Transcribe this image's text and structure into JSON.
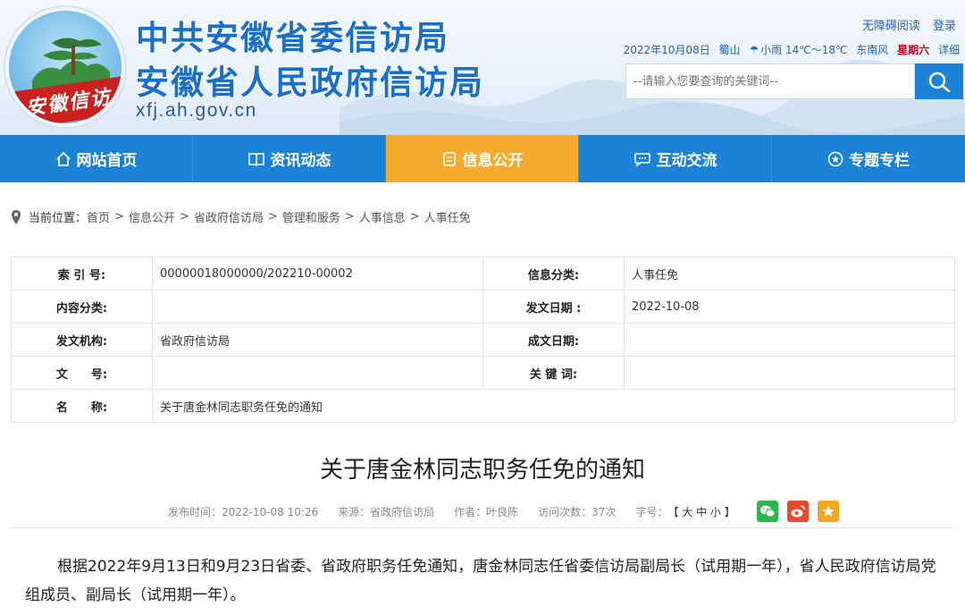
{
  "header": {
    "logo_text": "安徽信访",
    "title_line1": "中共安徽省委信访局",
    "title_line2": "安徽省人民政府信访局",
    "domain": "xfj.ah.gov.cn",
    "links": {
      "accessible": "无障碍阅读",
      "login": "登录"
    },
    "info": {
      "date": "2022年10月08日",
      "city": "蜀山",
      "weather": "小雨 14℃～18℃",
      "wind": "东南风",
      "weekday": "星期六",
      "detail": "详细"
    },
    "search": {
      "placeholder": "--请输入您要查询的关键词--"
    }
  },
  "nav": [
    {
      "label": "网站首页",
      "icon": "home-icon"
    },
    {
      "label": "资讯动态",
      "icon": "book-icon"
    },
    {
      "label": "信息公开",
      "icon": "document-icon",
      "active": true
    },
    {
      "label": "互动交流",
      "icon": "chat-icon"
    },
    {
      "label": "专题专栏",
      "icon": "star-circle-icon"
    }
  ],
  "breadcrumb": {
    "prefix": "当前位置：",
    "items": [
      "首页",
      "信息公开",
      "省政府信访局",
      "管理和服务",
      "人事信息",
      "人事任免"
    ]
  },
  "meta": {
    "rows": [
      {
        "k1": "索 引 号:",
        "v1": "00000018000000/202210-00002",
        "k2": "信息分类:",
        "v2": "人事任免"
      },
      {
        "k1": "内容分类:",
        "v1": "",
        "k2": "发文日期 :",
        "v2": "2022-10-08"
      },
      {
        "k1": "发文机构:",
        "v1": "省政府信访局",
        "k2": "成文日期:",
        "v2": ""
      },
      {
        "k1": "文　　号:",
        "v1": "",
        "k2": "关 键 词:",
        "v2": ""
      },
      {
        "k1": "名　　称:",
        "v1": "关于唐金林同志职务任免的通知"
      }
    ]
  },
  "article": {
    "title": "关于唐金林同志职务任免的通知",
    "publish_time": "发布时间：2022-10-08 10:26",
    "source": "来源：省政府信访局",
    "author": "作者：叶良陈",
    "visits": "访问次数：37次",
    "font_label": "字号：",
    "font_sizes": "【 大 中 小 】",
    "body": "根据2022年9月13日和9月23日省委、省政府职务任免通知，唐金林同志任省委信访局副局长（试用期一年），省人民政府信访局党组成员、副局长（试用期一年）。"
  },
  "colors": {
    "nav_bg": "#1b82d6",
    "nav_active": "#f6ab2e",
    "title_blue": "#1a6fc9",
    "weekday_red": "#d0021b"
  }
}
